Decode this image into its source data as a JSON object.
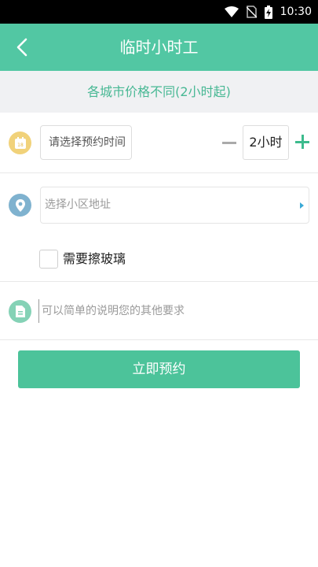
{
  "status_bar": {
    "time": "10:30",
    "icons": [
      "wifi-icon",
      "no-sim-icon",
      "battery-charging-icon"
    ]
  },
  "app_bar": {
    "title": "临时小时工",
    "back_icon": "chevron-left-icon"
  },
  "notice": {
    "text": "各城市价格不同(2小时起)"
  },
  "booking": {
    "time_placeholder": "请选择预约时间",
    "duration_value": "2小时",
    "address_placeholder": "选择小区地址",
    "glass_label": "需要擦玻璃",
    "remark_placeholder": "可以简单的说明您的其他要求"
  },
  "actions": {
    "submit_label": "立即预约"
  },
  "colors": {
    "primary": "#52c7a3",
    "accent_plus": "#3dbb8d",
    "calendar_icon": "#f1d27a",
    "location_icon": "#7fb2cf",
    "note_icon": "#85d2b6"
  }
}
